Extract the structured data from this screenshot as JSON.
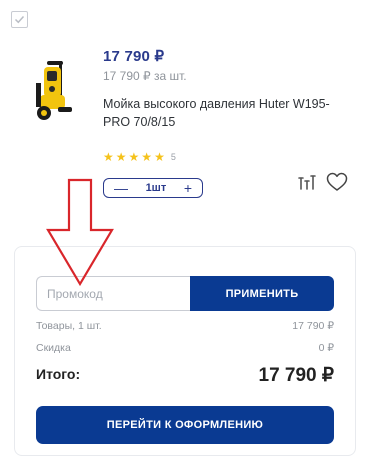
{
  "product": {
    "price": "17 790 ₽",
    "unit_price": "17 790 ₽ за шт.",
    "title": "Мойка высокого давления Huter W195-PRO 70/8/15",
    "rating_stars": 5,
    "rating_count": "5",
    "quantity": "1шт",
    "decrement_label": "—",
    "increment_label": "+"
  },
  "promo": {
    "placeholder": "Промокод",
    "apply_label": "ПРИМЕНИТЬ"
  },
  "summary": {
    "goods_label": "Товары, 1 шт.",
    "goods_value": "17 790 ₽",
    "discount_label": "Скидка",
    "discount_value": "0 ₽",
    "total_label": "Итого:",
    "total_value": "17 790 ₽",
    "checkout_label": "ПЕРЕЙТИ К ОФОРМЛЕНИЮ"
  },
  "colors": {
    "brand_blue": "#0a3a92",
    "star_yellow": "#f5c21b",
    "arrow_red": "#d9262b"
  }
}
